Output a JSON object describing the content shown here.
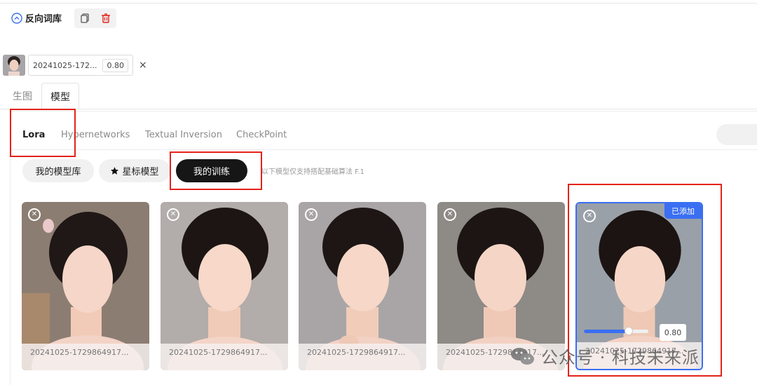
{
  "toolbar": {
    "negative_label": "反向词库"
  },
  "applied_lora": {
    "name": "20241025-172...",
    "weight": "0.80",
    "close": "×"
  },
  "main_tabs": [
    {
      "label": "生图"
    },
    {
      "label": "模型"
    }
  ],
  "sub_tabs": [
    {
      "label": "Lora"
    },
    {
      "label": "Hypernetworks"
    },
    {
      "label": "Textual Inversion"
    },
    {
      "label": "CheckPoint"
    }
  ],
  "filters": [
    {
      "label": "我的模型库"
    },
    {
      "label": "星标模型"
    },
    {
      "label": "我的训练"
    }
  ],
  "hint": "以下模型仅支持搭配基础算法 F.1",
  "cards": [
    {
      "caption": "20241025-1729864917..."
    },
    {
      "caption": "20241025-1729864917..."
    },
    {
      "caption": "20241025-1729864917..."
    },
    {
      "caption": "20241025-1729864917..."
    },
    {
      "caption": "20241025-1729864917...",
      "badge": "已添加",
      "weight": "0.80",
      "level": 0.7
    }
  ],
  "watermark": "公众号 · 科技未来派",
  "colors": {
    "accent": "#3a6ff2",
    "highlight_box": "#e2231a",
    "active_filter": "#161616"
  }
}
